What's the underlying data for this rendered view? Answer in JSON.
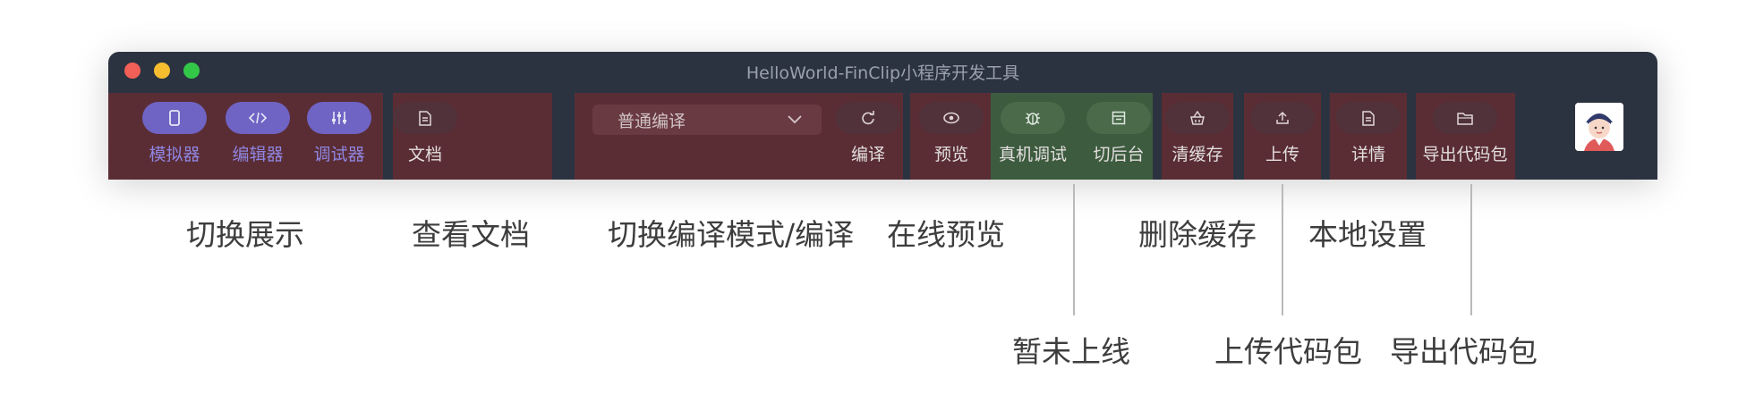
{
  "window": {
    "title": "HelloWorld-FinClip小程序开发工具"
  },
  "toolbar": {
    "simulator": {
      "label": "模拟器",
      "icon": "phone-icon"
    },
    "editor": {
      "label": "编辑器",
      "icon": "code-icon"
    },
    "debugger": {
      "label": "调试器",
      "icon": "sliders-icon"
    },
    "docs": {
      "label": "文档",
      "icon": "document-icon"
    },
    "compile_mode": {
      "value": "普通编译"
    },
    "compile": {
      "label": "编译",
      "icon": "refresh-icon"
    },
    "preview": {
      "label": "预览",
      "icon": "eye-icon"
    },
    "real_device_debug": {
      "label": "真机调试",
      "icon": "bug-icon"
    },
    "background": {
      "label": "切后台",
      "icon": "window-icon"
    },
    "clear_cache": {
      "label": "清缓存",
      "icon": "basket-icon"
    },
    "upload": {
      "label": "上传",
      "icon": "upload-icon"
    },
    "details": {
      "label": "详情",
      "icon": "file-text-icon"
    },
    "export_package": {
      "label": "导出代码包",
      "icon": "folder-icon"
    }
  },
  "annotations": {
    "switch_display": "切换展示",
    "view_docs": "查看文档",
    "switch_compile": "切换编译模式/编译",
    "online_preview": "在线预览",
    "not_online": "暂未上线",
    "delete_cache": "删除缓存",
    "local_settings": "本地设置",
    "upload_package": "上传代码包",
    "export_package": "导出代码包"
  },
  "colors": {
    "window_bg": "#2c3340",
    "group_red": "#5a2d35",
    "group_green": "#3d5b3e",
    "accent_purple": "#6f63c4"
  }
}
